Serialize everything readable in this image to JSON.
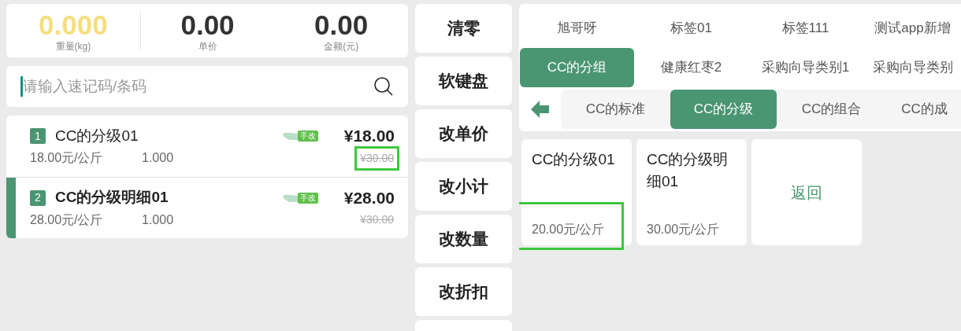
{
  "scale": [
    {
      "kind": "weight",
      "value": "0.000",
      "label": "重量(kg)"
    },
    {
      "kind": "money",
      "value": "0.00",
      "label": "单价"
    },
    {
      "kind": "money",
      "value": "0.00",
      "label": "金额(元)"
    }
  ],
  "search": {
    "placeholder": "请输入速记码/条码"
  },
  "order_items": [
    {
      "index": "1",
      "name": "CC的分级01",
      "badge": "手改",
      "price": "¥18.00",
      "unit_price": "18.00元/公斤",
      "quantity": "1.000",
      "original_price": "¥30.00",
      "selected": false,
      "highlighted": true
    },
    {
      "index": "2",
      "name": "CC的分级明细01",
      "badge": "手改",
      "price": "¥28.00",
      "unit_price": "28.00元/公斤",
      "quantity": "1.000",
      "original_price": "¥30.00",
      "selected": true,
      "highlighted": false
    }
  ],
  "actions": [
    "清零",
    "软键盘",
    "改单价",
    "改小计",
    "改数量",
    "改折扣"
  ],
  "tag_tabs": [
    {
      "label": "旭哥呀",
      "selected": false
    },
    {
      "label": "标签01",
      "selected": false
    },
    {
      "label": "标签111",
      "selected": false
    },
    {
      "label": "测试app新增",
      "selected": false
    }
  ],
  "category_tabs": [
    {
      "label": "CC的分组",
      "selected": true
    },
    {
      "label": "健康红枣2",
      "selected": false
    },
    {
      "label": "采购向导类别1",
      "selected": false
    },
    {
      "label": "采购向导类别",
      "selected": false
    }
  ],
  "subcategory_tabs": [
    {
      "label": "CC的标准",
      "selected": false
    },
    {
      "label": "CC的分级",
      "selected": true
    },
    {
      "label": "CC的组合",
      "selected": false
    },
    {
      "label": "CC的成",
      "selected": false
    }
  ],
  "products": [
    {
      "name": "CC的分级01",
      "price": "20.00元/公斤",
      "highlighted": true
    },
    {
      "name": "CC的分级明细01",
      "price": "30.00元/公斤",
      "highlighted": false
    }
  ],
  "back_card": {
    "label": "返回"
  }
}
